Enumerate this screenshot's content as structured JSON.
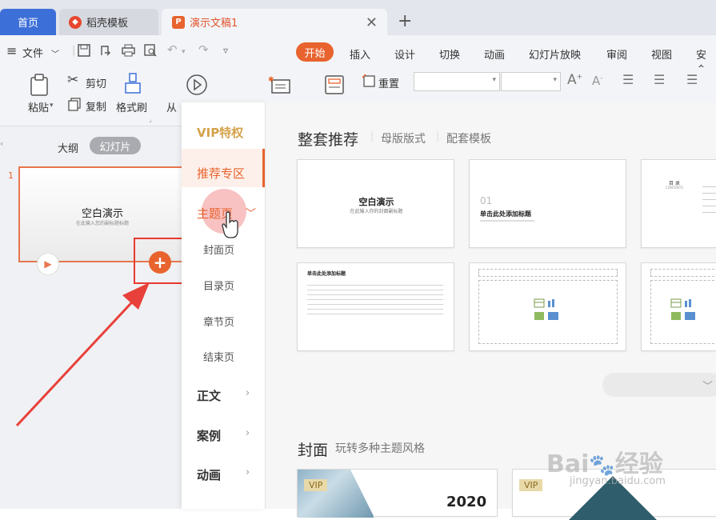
{
  "tabs": {
    "home": "首页",
    "templates": "稻壳模板",
    "document": "演示文稿1",
    "add": "+"
  },
  "menu": {
    "file": "文件",
    "items": [
      "开始",
      "插入",
      "设计",
      "切换",
      "动画",
      "幻灯片放映",
      "审阅",
      "视图",
      "安全"
    ]
  },
  "ribbon": {
    "paste": "粘贴",
    "cut": "剪切",
    "copy": "复制",
    "format_painter": "格式刷",
    "from": "从",
    "reset": "重置"
  },
  "leftpanel": {
    "outline": "大纲",
    "slides": "幻灯片",
    "slide_number": "1",
    "slide_title": "空白演示",
    "slide_subtitle": "在此输入您的副标题标题"
  },
  "category_menu": {
    "vip": "VIP特权",
    "recommended": "推荐专区",
    "theme": "主题页",
    "cover": "封面页",
    "toc": "目录页",
    "chapter": "章节页",
    "ending": "结束页",
    "body": "正文",
    "cases": "案例",
    "animation": "动画"
  },
  "content": {
    "section_title": "整套推荐",
    "master": "母版版式",
    "matching": "配套模板",
    "card1_title": "空白演示",
    "card1_sub": "在此输入你的封面副标题",
    "card2_num": "01",
    "card2_title": "单击此处添加标题",
    "card3_title": "目 录",
    "card3_sub": "CONTENTS",
    "card4_title": "单击此处添加标题",
    "cover_section": "封面",
    "cover_sub": "玩转多种主题风格",
    "vip_badge": "VIP",
    "year": "2020"
  },
  "watermark": {
    "brand": "Bai",
    "brand2": "经验",
    "url": "jingyan.baidu.com"
  },
  "colors": {
    "accent": "#e8632e",
    "tab_blue": "#3d6fd8",
    "arrow": "#e8403a"
  }
}
